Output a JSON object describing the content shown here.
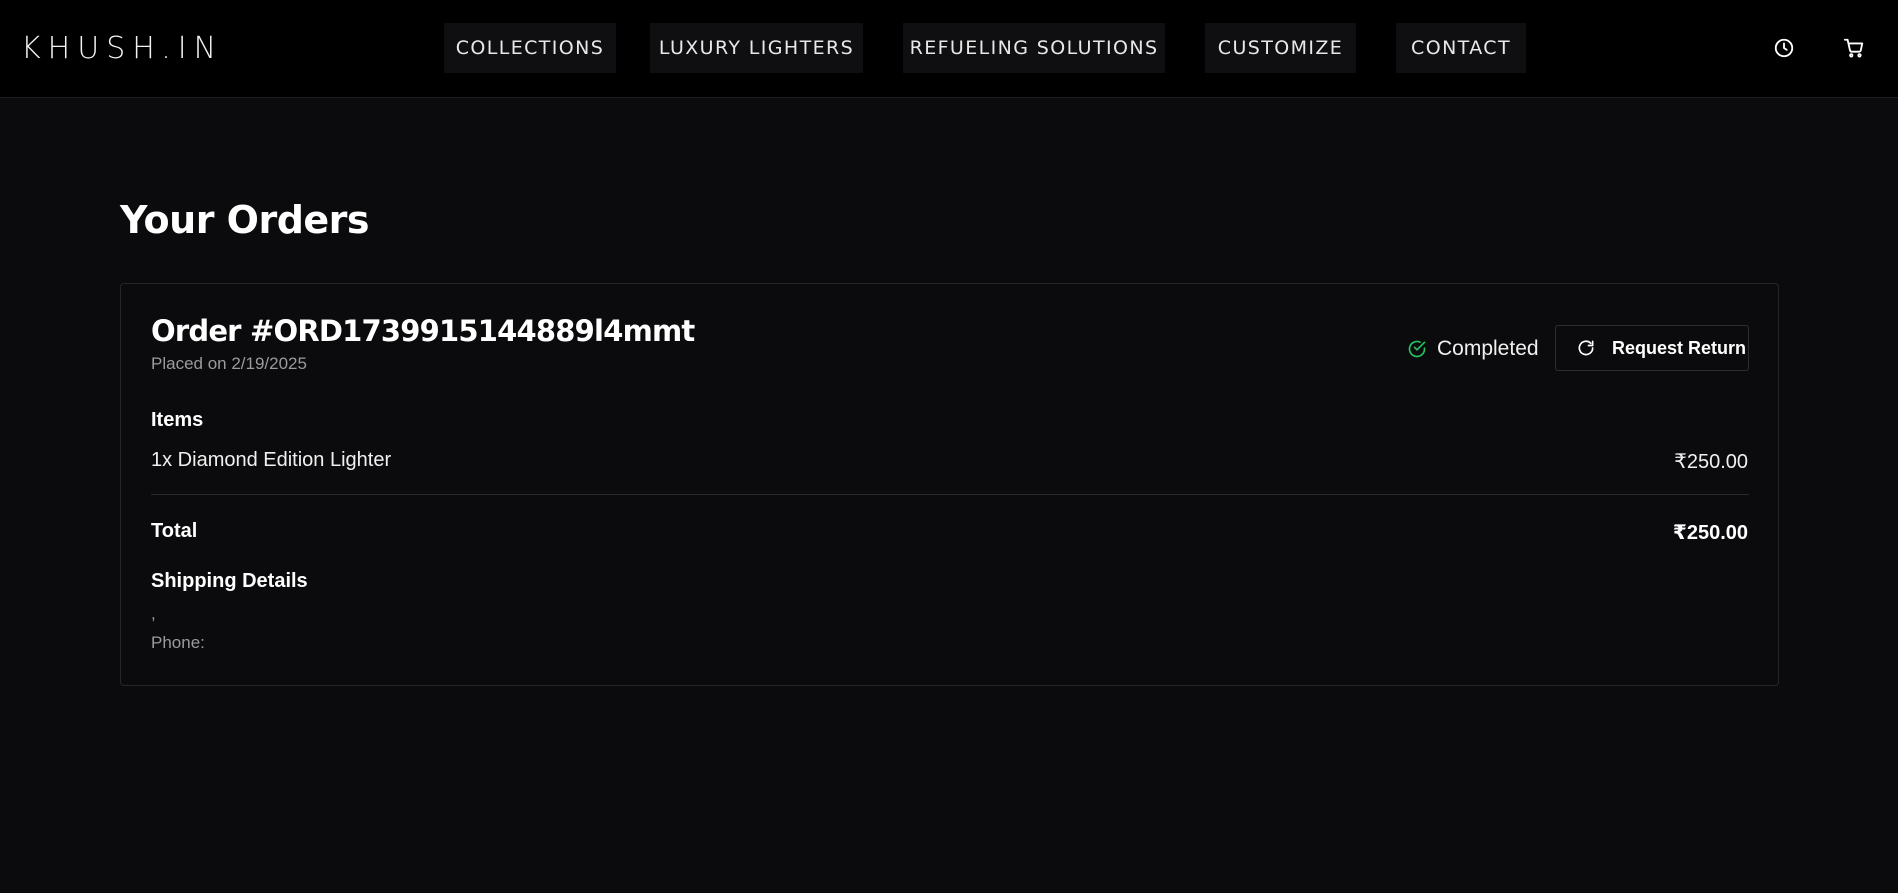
{
  "header": {
    "logo": "KHUSH.IN",
    "nav": [
      {
        "label": "COLLECTIONS"
      },
      {
        "label": "LUXURY LIGHTERS"
      },
      {
        "label": "REFUELING SOLUTIONS"
      },
      {
        "label": "CUSTOMIZE"
      },
      {
        "label": "CONTACT"
      }
    ],
    "icons": {
      "history": "clock-icon",
      "cart": "cart-icon"
    }
  },
  "main": {
    "title": "Your Orders",
    "order": {
      "id_label": "Order #ORD1739915144889l4mmt",
      "placed_on": "Placed on 2/19/2025",
      "status": "Completed",
      "status_color": "#22c55e",
      "return_button": "Request Return",
      "items_heading": "Items",
      "items": [
        {
          "name": "1x Diamond Edition Lighter",
          "price": "₹250.00"
        }
      ],
      "total_label": "Total",
      "total_value": "₹250.00",
      "shipping_heading": "Shipping Details",
      "shipping_address": ",",
      "shipping_phone": "Phone:"
    }
  }
}
